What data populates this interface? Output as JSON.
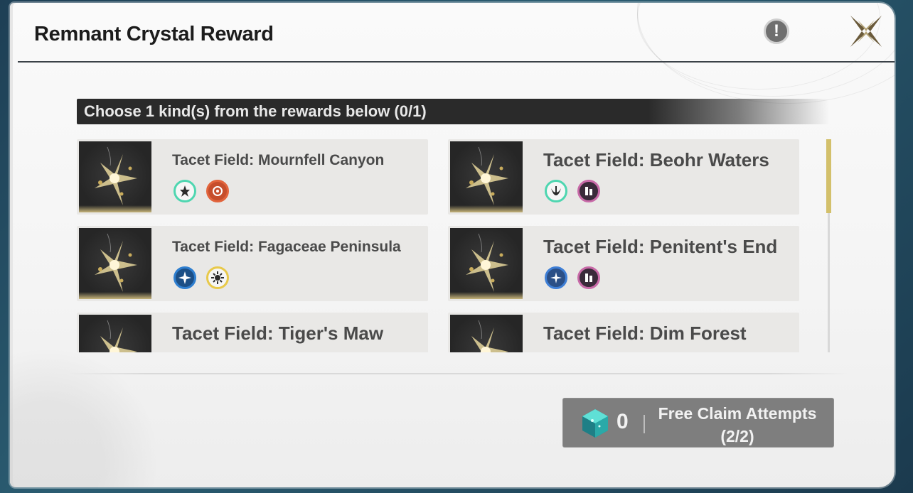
{
  "window": {
    "title": "Remnant Crystal Reward",
    "info_icon": "exclamation-icon",
    "info_glyph": "!",
    "close_icon": "close-x-icon"
  },
  "banner": {
    "text": "Choose 1 kind(s) from the rewards below (0/1)"
  },
  "rewards": [
    {
      "name": "Tacet Field: Mournfell Canyon",
      "icons": [
        "fleur-emblem-icon",
        "swirl-emblem-icon"
      ],
      "icon_colors": [
        "#4ed6b0",
        "#e2643c"
      ]
    },
    {
      "name": "Tacet Field: Beohr Waters",
      "icons": [
        "wing-emblem-icon",
        "tablet-emblem-icon"
      ],
      "icon_colors": [
        "#4ed6b0",
        "#c86aa8"
      ]
    },
    {
      "name": "Tacet Field: Fagaceae Peninsula",
      "icons": [
        "star-compass-emblem-icon",
        "sun-emblem-icon"
      ],
      "icon_colors": [
        "#2f7fd0",
        "#e8c94a"
      ]
    },
    {
      "name": "Tacet Field: Penitent's End",
      "icons": [
        "sparkle-emblem-icon",
        "tablet-emblem-icon"
      ],
      "icon_colors": [
        "#3f7fd6",
        "#c86aa8"
      ]
    },
    {
      "name": "Tacet Field: Tiger's Maw",
      "icons": [],
      "icon_colors": []
    },
    {
      "name": "Tacet Field: Dim Forest",
      "icons": [],
      "icon_colors": []
    }
  ],
  "footer": {
    "crystal_icon": "remnant-crystal-icon",
    "crystal_count": "0",
    "free_claim_label": "Free Claim Attempts",
    "free_claim_value": "(2/2)"
  },
  "colors": {
    "accent_gold": "#d3c06b",
    "banner_bg": "#2a2a2a",
    "card_bg": "#e9e8e6",
    "title_text": "#1c1c1c"
  }
}
